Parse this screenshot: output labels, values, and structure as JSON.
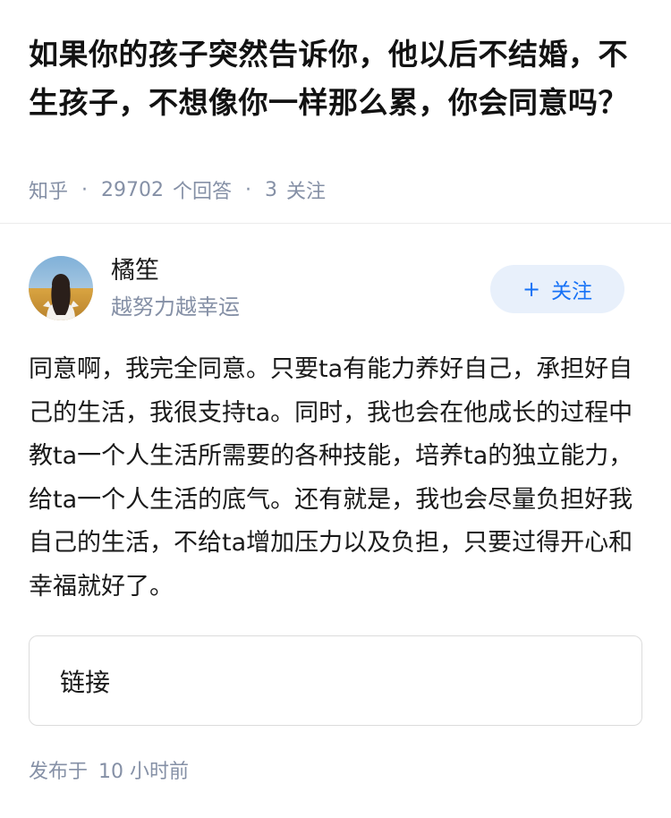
{
  "question": {
    "title": "如果你的孩子突然告诉你，他以后不结婚，不生孩子，不想像你一样那么累，你会同意吗？",
    "source": "知乎",
    "answer_count": "29702",
    "answer_count_label": "个回答",
    "follower_count": "3",
    "follower_label": "关注"
  },
  "author": {
    "name": "橘笙",
    "bio": "越努力越幸运",
    "follow_label": "关注",
    "follow_icon": "plus-icon"
  },
  "answer": {
    "content": "同意啊，我完全同意。只要ta有能力养好自己，承担好自己的生活，我很支持ta。同时，我也会在他成长的过程中教ta一个人生活所需要的各种技能，培养ta的独立能力，给ta一个人生活的底气。还有就是，我也会尽量负担好我自己的生活，不给ta增加压力以及负担，只要过得开心和幸福就好了。",
    "link_card_label": "链接",
    "publish_prefix": "发布于",
    "publish_time": "10 小时前"
  },
  "colors": {
    "title": "#121212",
    "meta": "#8590a6",
    "accent": "#1772f6",
    "follow_bg": "#e8f0fb"
  }
}
